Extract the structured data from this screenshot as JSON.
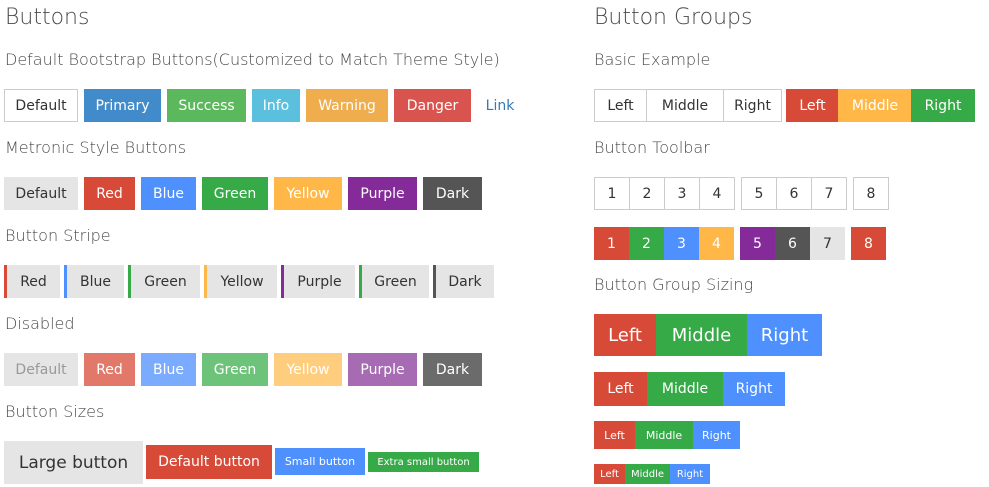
{
  "left": {
    "title": "Buttons",
    "default_section": {
      "heading": "Default Bootstrap Buttons(Customized to Match Theme Style)",
      "buttons": [
        {
          "label": "Default"
        },
        {
          "label": "Primary",
          "color": "#428bca"
        },
        {
          "label": "Success",
          "color": "#5cb85c"
        },
        {
          "label": "Info",
          "color": "#5bc0de"
        },
        {
          "label": "Warning",
          "color": "#f0ad4e"
        },
        {
          "label": "Danger",
          "color": "#d9534f"
        },
        {
          "label": "Link"
        }
      ]
    },
    "metronic_section": {
      "heading": "Metronic Style Buttons",
      "buttons": [
        {
          "label": "Default",
          "color": "#e5e5e5"
        },
        {
          "label": "Red",
          "color": "#d84a38"
        },
        {
          "label": "Blue",
          "color": "#4d90fe"
        },
        {
          "label": "Green",
          "color": "#35aa47"
        },
        {
          "label": "Yellow",
          "color": "#ffb848"
        },
        {
          "label": "Purple",
          "color": "#852b99"
        },
        {
          "label": "Dark",
          "color": "#555555"
        }
      ]
    },
    "stripe_section": {
      "heading": "Button Stripe",
      "buttons": [
        {
          "label": "Red",
          "color": "#d84a38"
        },
        {
          "label": "Blue",
          "color": "#4d90fe"
        },
        {
          "label": "Green",
          "color": "#35aa47"
        },
        {
          "label": "Yellow",
          "color": "#ffb848"
        },
        {
          "label": "Purple",
          "color": "#852b99"
        },
        {
          "label": "Green",
          "color": "#35aa47"
        },
        {
          "label": "Dark",
          "color": "#555555"
        }
      ]
    },
    "disabled_section": {
      "heading": "Disabled",
      "buttons": [
        {
          "label": "Default",
          "color": "#e5e5e5"
        },
        {
          "label": "Red",
          "color": "#e2786a"
        },
        {
          "label": "Blue",
          "color": "#7aabfe"
        },
        {
          "label": "Green",
          "color": "#6ec37a"
        },
        {
          "label": "Yellow",
          "color": "#ffcd7e"
        },
        {
          "label": "Purple",
          "color": "#a66bb3"
        },
        {
          "label": "Dark",
          "color": "#6b6b6b"
        }
      ]
    },
    "sizes_section": {
      "heading": "Button Sizes",
      "buttons": [
        {
          "label": "Large button",
          "color": "#e5e5e5"
        },
        {
          "label": "Default button",
          "color": "#d84a38"
        },
        {
          "label": "Small button",
          "color": "#4d90fe"
        },
        {
          "label": "Extra small button",
          "color": "#35aa47"
        }
      ]
    }
  },
  "right": {
    "title": "Button Groups",
    "basic_section": {
      "heading": "Basic Example",
      "group1": [
        "Left",
        "Middle",
        "Right"
      ],
      "group2": [
        {
          "label": "Left",
          "color": "#d84a38"
        },
        {
          "label": "Middle",
          "color": "#ffb848"
        },
        {
          "label": "Right",
          "color": "#35aa47"
        }
      ]
    },
    "toolbar_section": {
      "heading": "Button Toolbar",
      "outline_groups": [
        [
          "1",
          "2",
          "3",
          "4"
        ],
        [
          "5",
          "6",
          "7"
        ],
        [
          "8"
        ]
      ],
      "colored_groups": [
        [
          {
            "label": "1",
            "color": "#d84a38"
          },
          {
            "label": "2",
            "color": "#35aa47"
          },
          {
            "label": "3",
            "color": "#4d90fe"
          },
          {
            "label": "4",
            "color": "#ffb848"
          }
        ],
        [
          {
            "label": "5",
            "color": "#852b99"
          },
          {
            "label": "6",
            "color": "#555555"
          },
          {
            "label": "7",
            "color": "#e5e5e5"
          }
        ],
        [
          {
            "label": "8",
            "color": "#d84a38"
          }
        ]
      ]
    },
    "sizing_section": {
      "heading": "Button Group Sizing",
      "labels": [
        "Left",
        "Middle",
        "Right"
      ],
      "colors": [
        "#d84a38",
        "#35aa47",
        "#4d90fe"
      ]
    }
  }
}
